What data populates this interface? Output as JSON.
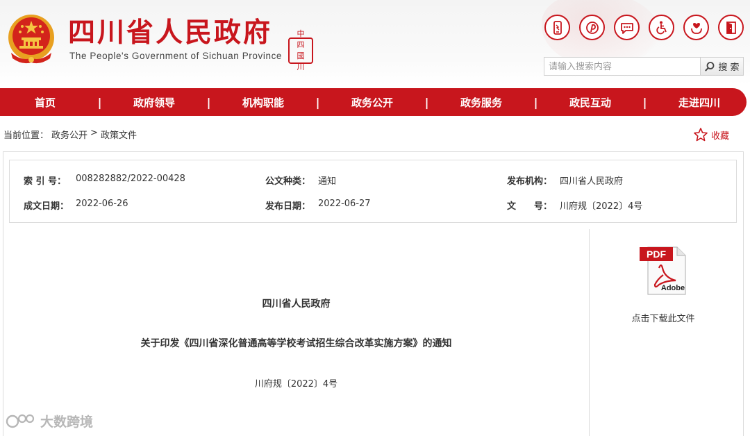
{
  "header": {
    "title": "四川省人民政府",
    "subtitle": "The People's Government of Sichuan Province",
    "seal_chars": [
      "中",
      "四",
      "國",
      "川"
    ]
  },
  "toolbar_icons": [
    {
      "name": "mobile-icon"
    },
    {
      "name": "weibo-icon"
    },
    {
      "name": "message-icon"
    },
    {
      "name": "accessibility-icon"
    },
    {
      "name": "elderly-care-icon"
    },
    {
      "name": "exit-icon"
    }
  ],
  "search": {
    "placeholder": "请输入搜索内容",
    "button_label": "搜 索"
  },
  "nav": {
    "items": [
      "首页",
      "政府领导",
      "机构职能",
      "政务公开",
      "政务服务",
      "政民互动",
      "走进四川"
    ],
    "separator": "|"
  },
  "breadcrumb": {
    "prefix": "当前位置：",
    "items": [
      "政务公开",
      "政策文件"
    ],
    "separator": ">"
  },
  "favorite": {
    "label": "收藏"
  },
  "meta": {
    "index_label": "索 引 号：",
    "index_value": "008282882/2022-00428",
    "type_label": "公文种类：",
    "type_value": "通知",
    "issuer_label": "发布机构：",
    "issuer_value": "四川省人民政府",
    "created_label": "成文日期：",
    "created_value": "2022-06-26",
    "published_label": "发布日期：",
    "published_value": "2022-06-27",
    "docno_label": "文　　号：",
    "docno_value": "川府规〔2022〕4号"
  },
  "document": {
    "issuer": "四川省人民政府",
    "title": "关于印发《四川省深化普通高等学校考试招生综合改革实施方案》的通知",
    "number": "川府规〔2022〕4号"
  },
  "download": {
    "pdf_text": "PDF",
    "adobe_text": "Adobe",
    "caption": "点击下载此文件"
  },
  "watermark": {
    "text": "大数跨境"
  },
  "colors": {
    "brand_red": "#c8161d",
    "border_gray": "#dcdcdc"
  }
}
